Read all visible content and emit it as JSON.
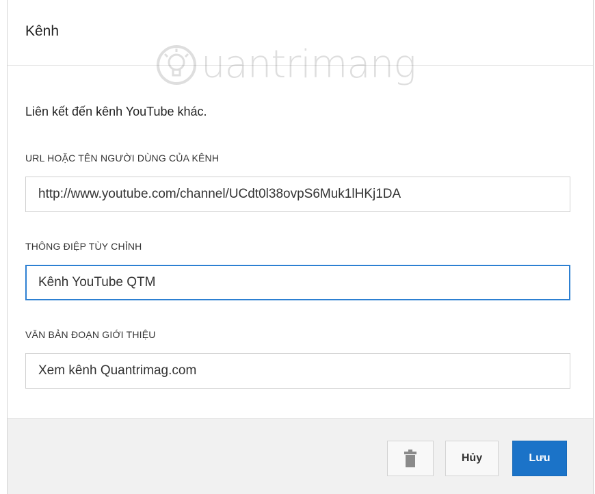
{
  "dialog": {
    "title": "Kênh",
    "watermark": "uantrimang",
    "intro": "Liên kết đến kênh YouTube khác.",
    "fields": [
      {
        "label": "URL HOẶC TÊN NGƯỜI DÙNG CỦA KÊNH",
        "value": "http://www.youtube.com/channel/UCdt0l38ovpS6Muk1lHKj1DA"
      },
      {
        "label": "THÔNG ĐIỆP TÙY CHỈNH",
        "value": "Kênh YouTube QTM"
      },
      {
        "label": "VĂN BẢN ĐOẠN GIỚI THIỆU",
        "value": "Xem kênh Quantrimag.com"
      }
    ]
  },
  "footer": {
    "delete_icon": "trash-icon",
    "cancel_label": "Hủy",
    "save_label": "Lưu"
  },
  "colors": {
    "accent": "#1b73c8",
    "focus_border": "#2d80d2",
    "footer_bg": "#f1f1f1"
  }
}
